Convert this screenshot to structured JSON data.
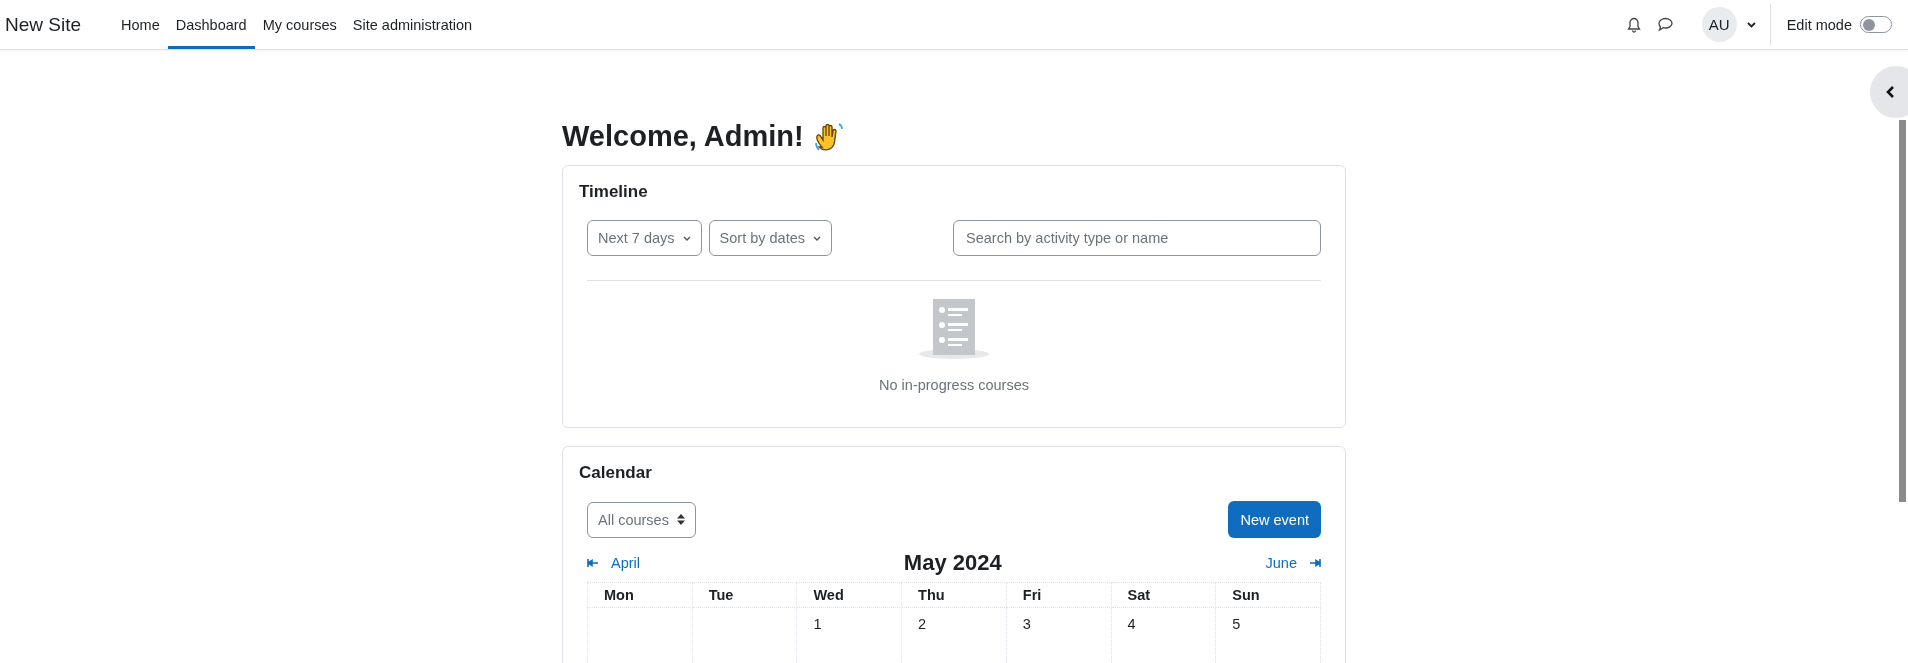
{
  "navbar": {
    "site_name": "New Site",
    "links": [
      {
        "label": "Home",
        "selected": false
      },
      {
        "label": "Dashboard",
        "selected": true
      },
      {
        "label": "My courses",
        "selected": false
      },
      {
        "label": "Site administration",
        "selected": false
      }
    ],
    "avatar": "AU",
    "edit_mode": {
      "label": "Edit mode",
      "on": false
    }
  },
  "heading": "Welcome, Admin!",
  "timeline": {
    "title": "Timeline",
    "filters": [
      "Next 7 days",
      "Sort by dates"
    ],
    "search": {
      "placeholder": "Search by activity type or name"
    },
    "empty_message": "No in-progress courses"
  },
  "calendar": {
    "title": "Calendar",
    "course_select": "All courses",
    "new_event": "New event",
    "prev": "April",
    "month": "May 2024",
    "next": "June",
    "weekdays": [
      "Mon",
      "Tue",
      "Wed",
      "Thu",
      "Fri",
      "Sat",
      "Sun"
    ],
    "rows": [
      {
        "cells": [
          {
            "kind": "blank"
          },
          {
            "kind": "blank"
          },
          {
            "kind": "day",
            "label": "1"
          },
          {
            "kind": "day",
            "label": "2"
          },
          {
            "kind": "day",
            "label": "3"
          },
          {
            "kind": "day",
            "label": "4"
          },
          {
            "kind": "day",
            "label": "5"
          }
        ]
      }
    ]
  }
}
